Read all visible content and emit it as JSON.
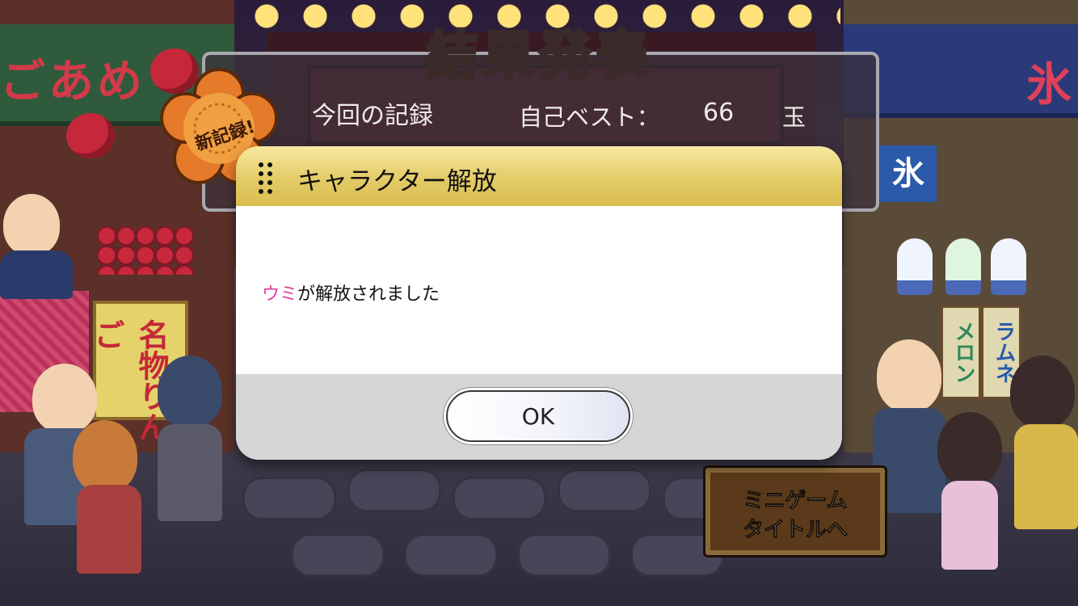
{
  "results": {
    "title": "結果発表",
    "record_label": "今回の記録",
    "best_label": "自己ベスト：",
    "best_value": "66",
    "best_unit": "玉",
    "new_record_badge": "新記録!"
  },
  "dialog": {
    "title": "キャラクター解放",
    "message_highlight": "ウミ",
    "message_rest": "が解放されました",
    "highlight_color": "#e040a0",
    "ok_label": "OK"
  },
  "minigame_button": {
    "line1": "ミニゲーム",
    "line2": "タイトルへ"
  },
  "background": {
    "left_banner": "ごあめ",
    "left_sign": "名物りんご",
    "right_banner": "氷",
    "right_ice_sign": "氷",
    "flags": [
      "メロン",
      "ラムネ"
    ]
  }
}
